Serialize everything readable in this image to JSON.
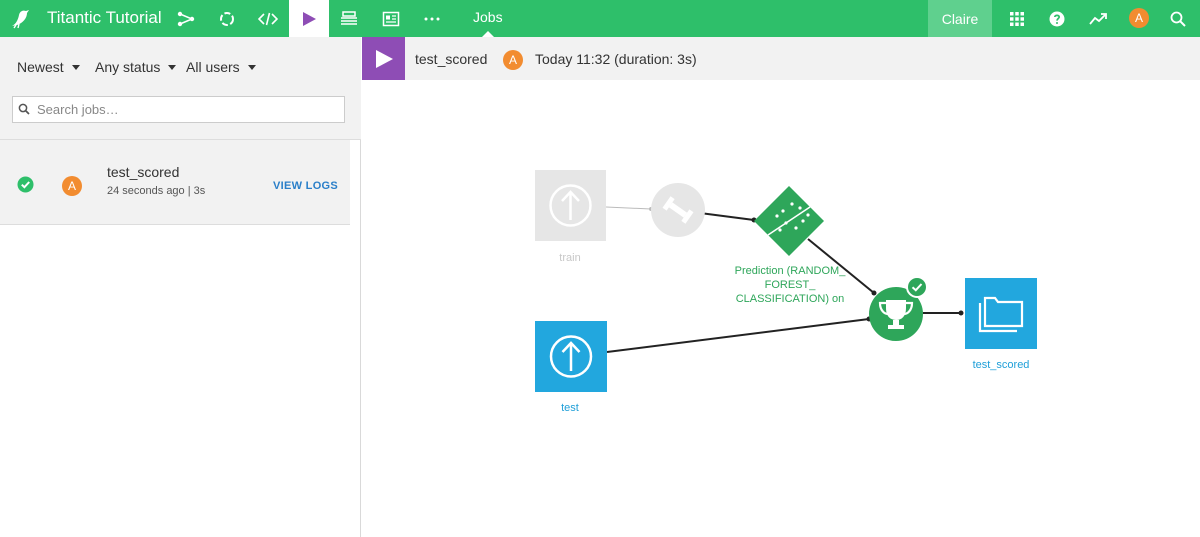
{
  "app": {
    "project_title": "Titantic Tutorial",
    "active_section": "Jobs",
    "user_name": "Claire",
    "user_initial": "A",
    "brand_color": "#2ebf6a"
  },
  "nav_icons": [
    "flow-icon",
    "recipes-icon",
    "code-icon",
    "jobs-icon",
    "datasets-icon",
    "dashboard-icon",
    "more-icon"
  ],
  "right_icons": [
    "apps-grid-icon",
    "help-icon",
    "trend-icon",
    "search-icon"
  ],
  "filters": {
    "sort": "Newest",
    "status": "Any status",
    "users": "All users",
    "search_placeholder": "Search jobs…"
  },
  "jobs": [
    {
      "name": "test_scored",
      "status": "success",
      "initial": "A",
      "meta": "24 seconds ago | 3s",
      "action": "VIEW LOGS"
    }
  ],
  "job_header": {
    "name": "test_scored",
    "initial": "A",
    "time": "Today 11:32 (duration: 3s)"
  },
  "flow": {
    "train_label": "train",
    "test_label": "test",
    "prediction_label": "Prediction (RANDOM_ FOREST_ CLASSIFICATION) on",
    "output_label": "test_scored"
  }
}
